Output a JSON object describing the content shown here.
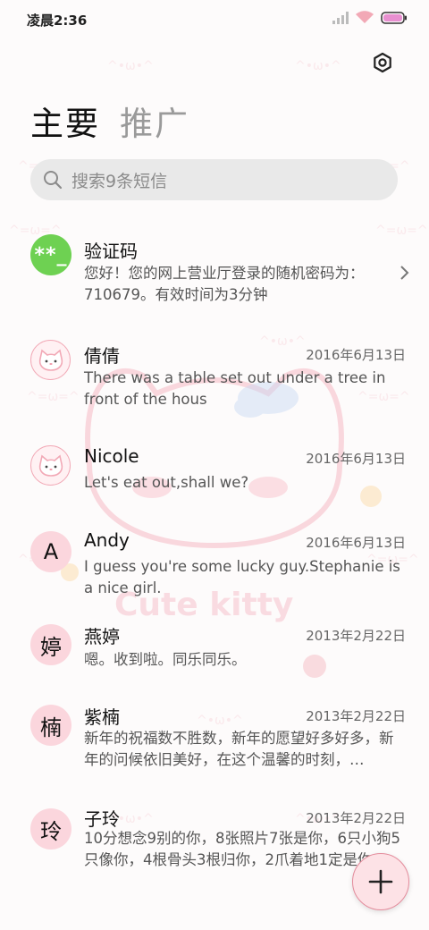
{
  "status_bar": {
    "time": "凌晨2:36",
    "icons": [
      "cellular-signal-icon",
      "wifi-icon",
      "battery-icon"
    ]
  },
  "settings": {
    "icon": "settings-gear-icon"
  },
  "tabs": [
    {
      "label": "主要",
      "active": true
    },
    {
      "label": "推广",
      "active": false
    }
  ],
  "search": {
    "placeholder": "搜索9条短信",
    "icon": "search-icon"
  },
  "watermark": {
    "text": "Cute kitty"
  },
  "conversations": [
    {
      "name": "验证码",
      "date": "",
      "avatar": "**_",
      "avatar_type": "green",
      "preview": "您好！您的网上营业厅登录的随机密码为：710679。有效时间为3分钟",
      "has_chevron": true
    },
    {
      "name": "倩倩",
      "date": "2016年6月13日",
      "avatar": "",
      "avatar_type": "kitty",
      "preview": "There was a table set out under a tree in front of the hous",
      "has_chevron": false
    },
    {
      "name": "Nicole",
      "date": "2016年6月13日",
      "avatar": "",
      "avatar_type": "kitty",
      "preview": "Let's eat out,shall we?",
      "has_chevron": false
    },
    {
      "name": "Andy",
      "date": "2016年6月13日",
      "avatar": "A",
      "avatar_type": "letter",
      "preview": "I guess you're some lucky guy.Stephanie is a nice girl.",
      "has_chevron": false
    },
    {
      "name": "燕婷",
      "date": "2013年2月22日",
      "avatar": "婷",
      "avatar_type": "letter",
      "preview": "嗯。收到啦。同乐同乐。",
      "has_chevron": false
    },
    {
      "name": "紫楠",
      "date": "2013年2月22日",
      "avatar": "楠",
      "avatar_type": "letter",
      "preview": "新年的祝福数不胜数，新年的愿望好多好多，新年的问候依旧美好，在这个温馨的时刻，…",
      "has_chevron": false
    },
    {
      "name": "子玲",
      "date": "2013年2月22日",
      "avatar": "玲",
      "avatar_type": "letter",
      "preview": "10分想念9别的你，8张照片7张是你，6只小狗5只像你，4根骨头3根归你，2爪着地1定是你",
      "has_chevron": false
    }
  ],
  "fab": {
    "icon": "plus-icon"
  },
  "colors": {
    "accent_pink": "#f2a9b6",
    "avatar_pink": "#fbd6dd",
    "code_green": "#6ed152",
    "fab_bg": "#fde2e6"
  }
}
